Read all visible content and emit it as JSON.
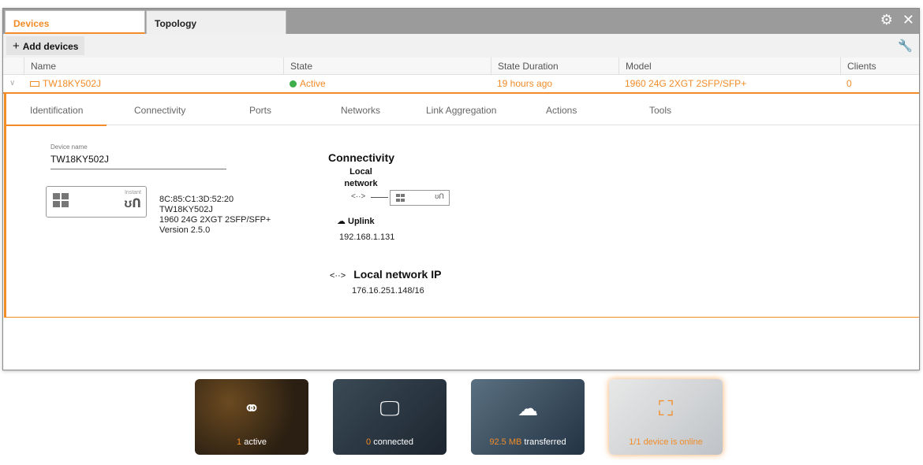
{
  "tabs": {
    "devices": "Devices",
    "topology": "Topology"
  },
  "toolbar": {
    "add_devices": "Add devices"
  },
  "table": {
    "headers": {
      "name": "Name",
      "state": "State",
      "duration": "State Duration",
      "model": "Model",
      "clients": "Clients"
    },
    "row": {
      "name": "TW18KY502J",
      "state": "Active",
      "duration": "19 hours ago",
      "model": "1960 24G 2XGT 2SFP/SFP+",
      "clients": "0"
    }
  },
  "subtabs": [
    "Identification",
    "Connectivity",
    "Ports",
    "Networks",
    "Link Aggregation",
    "Actions",
    "Tools"
  ],
  "identification": {
    "device_name_label": "Device name",
    "device_name": "TW18KY502J",
    "brand_small": "Instant",
    "brand_logo": "ʊՈ",
    "mac": "8C:85:C1:3D:52:20",
    "serial": "TW18KY502J",
    "model": "1960 24G 2XGT 2SFP/SFP+",
    "version": "Version 2.5.0"
  },
  "connectivity": {
    "title": "Connectivity",
    "local_network_label_1": "Local",
    "local_network_label_2": "network",
    "uplink_label": "Uplink",
    "uplink_ip": "192.168.1.131",
    "local_ip_title": "Local network IP",
    "local_ip": "176.16.251.148/16"
  },
  "cards": [
    {
      "value": "1",
      "unit": "",
      "label": "active",
      "icon": "network-icon"
    },
    {
      "value": "0",
      "label": "connected",
      "icon": "devices-icon"
    },
    {
      "value": "92.5 MB",
      "label": "transferred",
      "icon": "cloud-transfer-icon"
    },
    {
      "value": "1/1 device is online",
      "label": "",
      "icon": "topology-icon"
    }
  ],
  "colors": {
    "accent": "#f28c28",
    "active": "#3cae4a"
  }
}
